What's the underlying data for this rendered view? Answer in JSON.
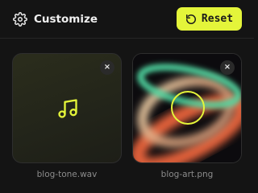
{
  "header": {
    "title": "Customize",
    "reset_label": "Reset",
    "icon": "gear-icon"
  },
  "colors": {
    "accent": "#e4f53a",
    "background": "#141414"
  },
  "files": [
    {
      "name": "blog-tone.wav",
      "type": "audio",
      "icon": "music-note-icon"
    },
    {
      "name": "blog-art.png",
      "type": "image"
    }
  ],
  "remove_glyph": "×"
}
